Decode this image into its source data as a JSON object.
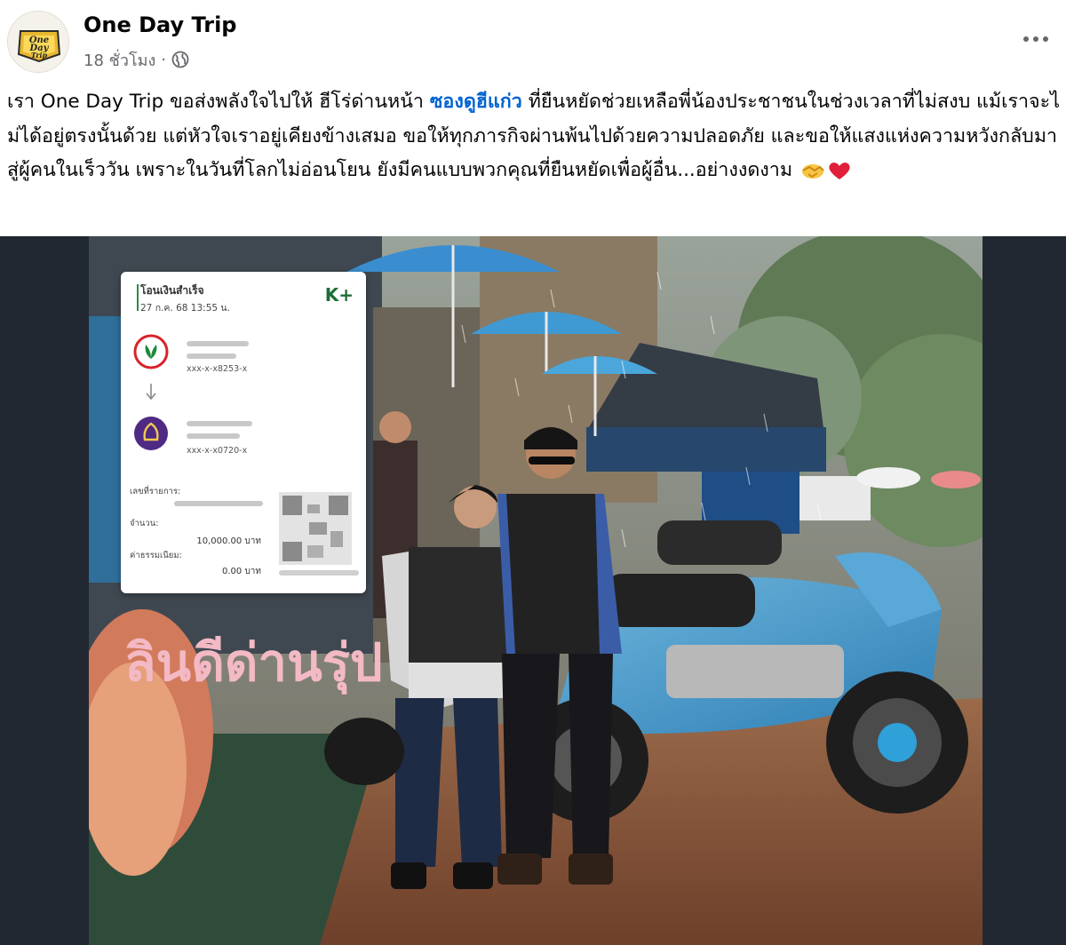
{
  "post": {
    "page_name": "One Day Trip",
    "time": "18 ชั่วโมง",
    "separator": "·",
    "privacy_icon": "globe-icon",
    "more_icon": "more-options-icon",
    "avatar_logo_text": "One Day Trip"
  },
  "caption": {
    "part1": "เรา One Day Trip ขอส่งพลังใจไปให้ ฮีโร่ด่านหน้า ",
    "mention": "ซองดูฮีแก่ว",
    "part2": "  ที่ยืนหยัดช่วยเหลือพี่น้องประชาชนในช่วงเวลาที่ไม่สงบ แม้เราจะไม่ได้อยู่ตรงนั้นด้วย แต่หัวใจเราอยู่เคียงข้างเสมอ ขอให้ทุกภารกิจผ่านพ้นไปด้วยความปลอดภัย และขอให้แสงแห่งความหวังกลับมาสู่ผู้คนในเร็ววัน เพราะในวันที่โลกไม่อ่อนโยน ยังมีคนแบบพวกคุณที่ยืนหยัดเพื่อผู้อื่น...อย่างงดงาม ",
    "emojis": [
      "handshake-emoji",
      "red-heart-emoji"
    ]
  },
  "slip": {
    "title": "โอนเงินสำเร็จ",
    "date": "27 ก.ค. 68  13:55 น.",
    "brand": "K+",
    "sender_account": "xxx-x-x8253-x",
    "receiver_account": "xxx-x-x0720-x",
    "ref_label": "เลขที่รายการ:",
    "amount_label": "จำนวน:",
    "amount": "10,000.00 บาท",
    "fee_label": "ค่าธรรมเนียม:",
    "fee": "0.00 บาท"
  },
  "colors": {
    "mention": "#0064d1",
    "meta": "#65676b",
    "photo_background": "#222831",
    "kbank_green": "#1d6e37",
    "scb_purple": "#4e2a84"
  }
}
